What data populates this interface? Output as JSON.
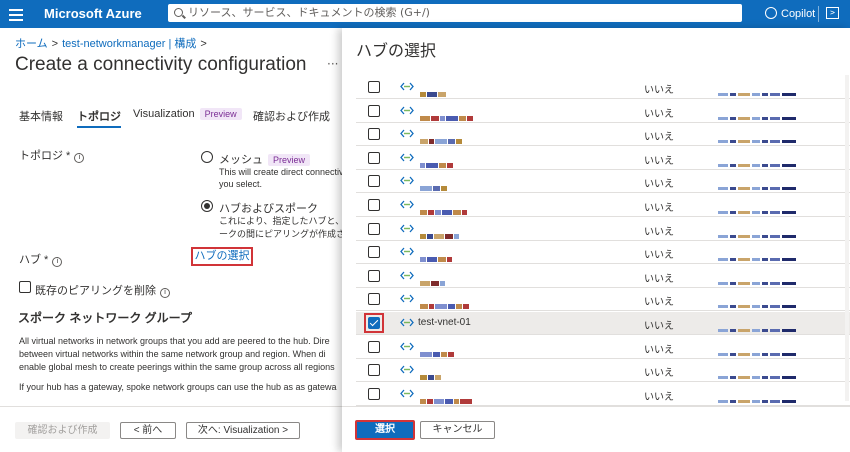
{
  "topbar": {
    "brand": "Microsoft Azure",
    "search_placeholder": "リソース、サービス、ドキュメントの検索 (G+/)",
    "copilot": "Copilot"
  },
  "breadcrumb": [
    "ホーム",
    "test-networkmanager | 構成"
  ],
  "page_title": "Create a connectivity configuration",
  "tabs": [
    {
      "label": "基本情報"
    },
    {
      "label": "トポロジ"
    },
    {
      "label": "Visualization",
      "badge": "Preview"
    },
    {
      "label": "確認および作成"
    }
  ],
  "form": {
    "topology_label": "トポロジ *",
    "mesh_label": "メッシュ",
    "mesh_badge": "Preview",
    "mesh_desc1": "This will create direct connectivit",
    "mesh_desc2": "you select.",
    "hubspoke_label": "ハブおよびスポーク",
    "hubspoke_desc1": "これにより、指定したハブと、ま",
    "hubspoke_desc2": "ークの間にピアリングが作成され",
    "hub_label": "ハブ *",
    "hub_select_link": "ハブの選択",
    "delete_peering": "既存のピアリングを削除"
  },
  "spoke": {
    "title": "スポーク ネットワーク グループ",
    "p1": "All virtual networks in network groups that you add are peered to the hub. Dire",
    "p2": "between virtual networks within the same network group and region. When di",
    "p3": "enable global mesh to create peerings within the same group across all regions",
    "p4": "If your hub has a gateway, spoke network groups can use the hub as as gatewa"
  },
  "footer": {
    "review": "確認および作成",
    "prev": "< 前へ",
    "next": "次へ: Visualization >"
  },
  "panel": {
    "title": "ハブの選択",
    "rows": [
      {
        "name": "",
        "value": "いいえ",
        "selected": false
      },
      {
        "name": "",
        "value": "いいえ",
        "selected": false
      },
      {
        "name": "",
        "value": "いいえ",
        "selected": false
      },
      {
        "name": "",
        "value": "いいえ",
        "selected": false
      },
      {
        "name": "",
        "value": "いいえ",
        "selected": false
      },
      {
        "name": "",
        "value": "いいえ",
        "selected": false
      },
      {
        "name": "",
        "value": "いいえ",
        "selected": false
      },
      {
        "name": "",
        "value": "いいえ",
        "selected": false
      },
      {
        "name": "",
        "value": "いいえ",
        "selected": false
      },
      {
        "name": "",
        "value": "いいえ",
        "selected": false
      },
      {
        "name": "test-vnet-01",
        "value": "いいえ",
        "selected": true
      },
      {
        "name": "",
        "value": "いいえ",
        "selected": false
      },
      {
        "name": "",
        "value": "いいえ",
        "selected": false
      },
      {
        "name": "",
        "value": "いいえ",
        "selected": false
      }
    ],
    "select_button": "選択",
    "cancel_button": "キャンセル"
  },
  "colors": {
    "accent": "#0f6cbd",
    "highlight": "#d13438"
  }
}
